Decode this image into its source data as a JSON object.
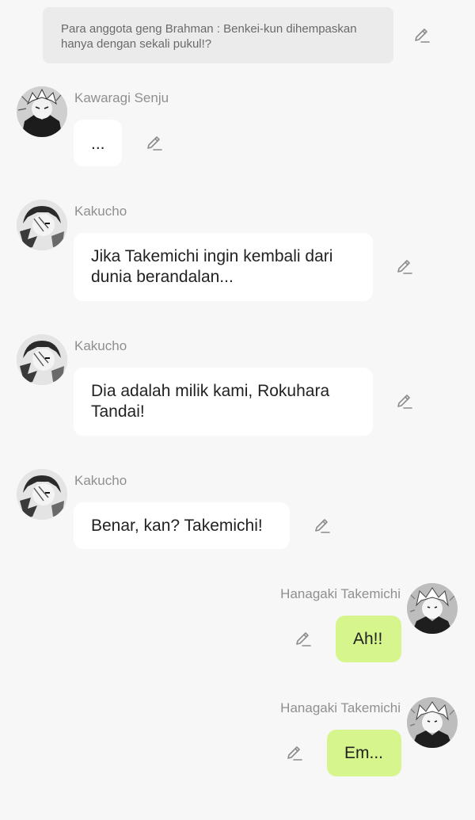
{
  "narration": {
    "text": "Para anggota geng Brahman : Benkei-kun dihempaskan hanya dengan sekali pukul!?"
  },
  "messages": [
    {
      "sender": "Kawaragi Senju",
      "text": "..."
    },
    {
      "sender": "Kakucho",
      "text": "Jika Takemichi ingin kembali dari dunia berandalan..."
    },
    {
      "sender": "Kakucho",
      "text": "Dia adalah milik kami, Rokuhara Tandai!"
    },
    {
      "sender": "Kakucho",
      "text": "Benar, kan? Takemichi!"
    },
    {
      "sender": "Hanagaki Takemichi",
      "text": "Ah!!"
    },
    {
      "sender": "Hanagaki Takemichi",
      "text": "Em..."
    }
  ],
  "icons": {
    "edit": "pencil-edit-icon"
  },
  "colors": {
    "background": "#f7f7f7",
    "narration_bg": "#ebebeb",
    "incoming_bubble": "#ffffff",
    "outgoing_bubble": "#d6f58d",
    "name_text": "#8f8f8f"
  }
}
